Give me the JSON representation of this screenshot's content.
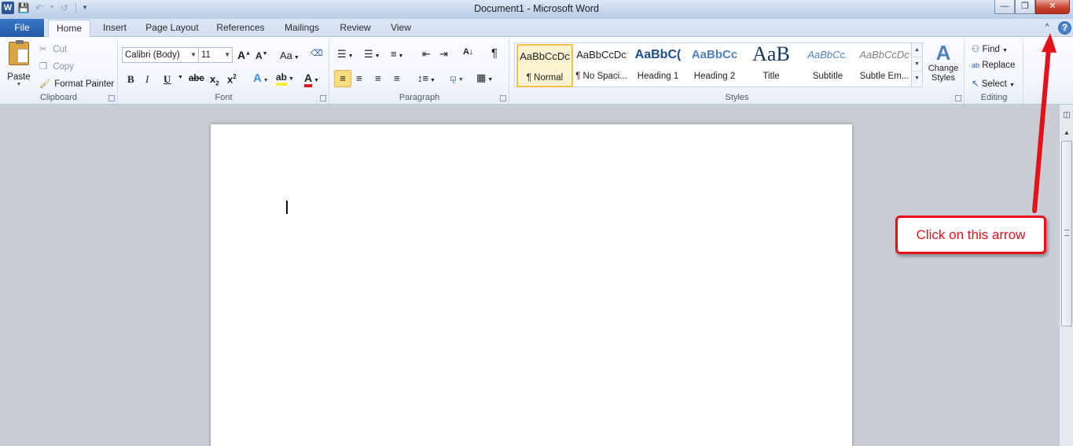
{
  "window": {
    "title": "Document1  -  Microsoft Word"
  },
  "qat": {
    "app_icon": "W"
  },
  "tabs": {
    "file": "File",
    "items": [
      {
        "label": "Home",
        "active": true
      },
      {
        "label": "Insert"
      },
      {
        "label": "Page Layout"
      },
      {
        "label": "References"
      },
      {
        "label": "Mailings"
      },
      {
        "label": "Review"
      },
      {
        "label": "View"
      }
    ]
  },
  "clipboard": {
    "label": "Clipboard",
    "paste": "Paste",
    "cut": "Cut",
    "copy": "Copy",
    "format_painter": "Format Painter"
  },
  "font": {
    "label": "Font",
    "family": "Calibri (Body)",
    "size": "11",
    "grow": "A",
    "shrink": "A",
    "change_case": "Aa",
    "bold": "B",
    "italic": "I",
    "underline": "U",
    "strike": "abc",
    "subscript": "x",
    "superscript": "x",
    "effects": "A",
    "highlight": "ab",
    "color": "A"
  },
  "paragraph": {
    "label": "Paragraph",
    "sort": "A↓",
    "pilcrow": "¶"
  },
  "styles": {
    "label": "Styles",
    "items": [
      {
        "sample": "AaBbCcDc",
        "name": "¶ Normal"
      },
      {
        "sample": "AaBbCcDc",
        "name": "¶ No Spaci..."
      },
      {
        "sample": "AaBbC(",
        "name": "Heading 1"
      },
      {
        "sample": "AaBbCc",
        "name": "Heading 2"
      },
      {
        "sample": "AaB",
        "name": "Title"
      },
      {
        "sample": "AaBbCc.",
        "name": "Subtitle"
      },
      {
        "sample": "AaBbCcDc",
        "name": "Subtle Em..."
      }
    ],
    "change_styles": "Change Styles"
  },
  "editing": {
    "label": "Editing",
    "find": "Find",
    "replace": "Replace",
    "select": "Select"
  },
  "annotation": {
    "text": "Click on this arrow",
    "color": "#e5101a"
  }
}
